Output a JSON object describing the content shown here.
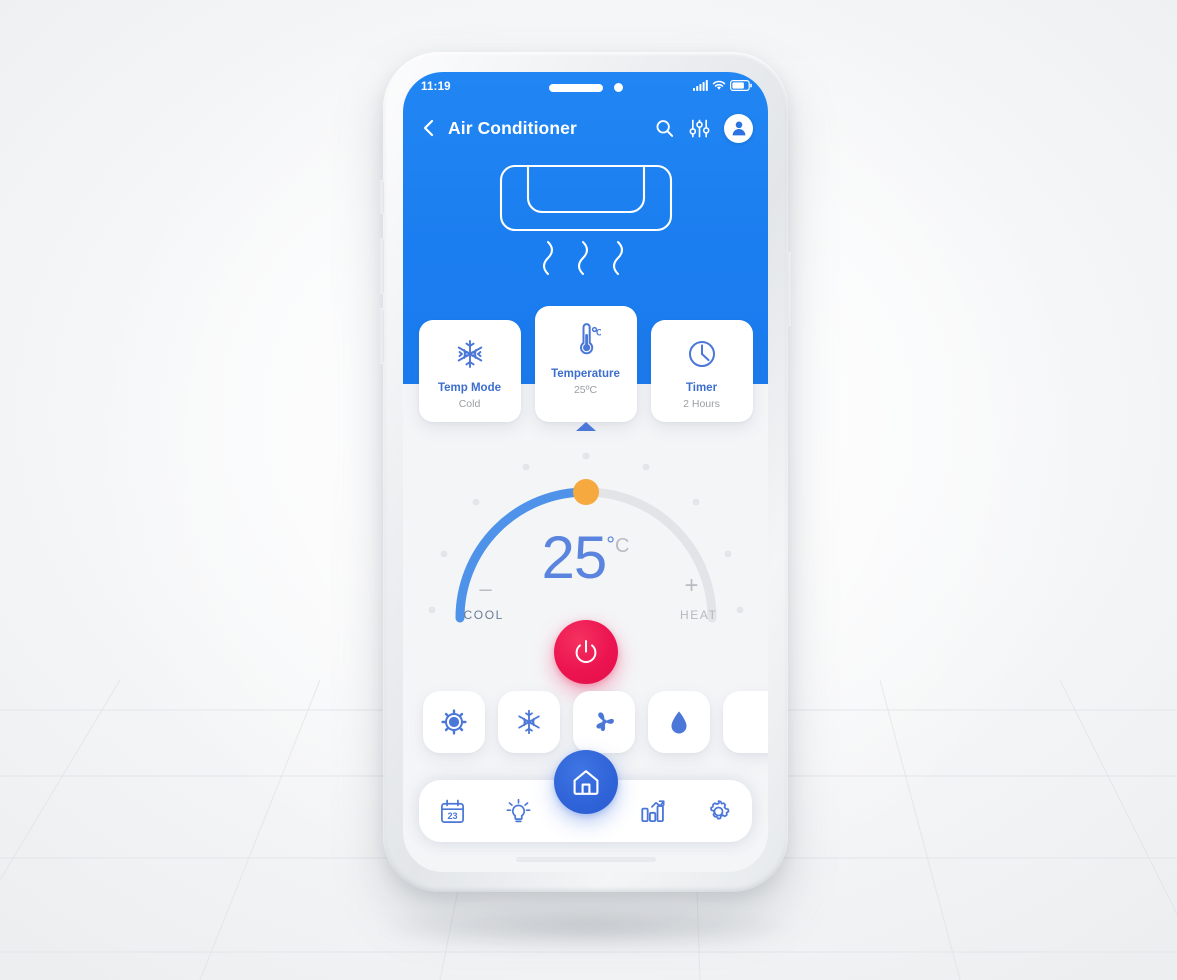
{
  "status_bar": {
    "time": "11:19",
    "icons": [
      "signal-icon",
      "wifi-icon",
      "battery-icon"
    ]
  },
  "app_bar": {
    "back_icon": "chevron-left-icon",
    "title": "Air Conditioner",
    "actions": [
      "search-icon",
      "sliders-icon",
      "user-avatar-icon"
    ]
  },
  "hero": {
    "illustration": "air-conditioner-unit-icon",
    "airflow_lines": 3
  },
  "cards": [
    {
      "icon": "snowflake-icon",
      "title": "Temp Mode",
      "value": "Cold",
      "active": false
    },
    {
      "icon": "thermometer-icon",
      "title": "Temperature",
      "value": "25ºC",
      "active": true
    },
    {
      "icon": "clock-icon",
      "title": "Timer",
      "value": "2 Hours",
      "active": false
    }
  ],
  "dial": {
    "temperature": "25",
    "degree_symbol": "°",
    "unit": "C",
    "minus_label": "–",
    "plus_label": "+",
    "cool_label": "COOL",
    "heat_label": "HEAT",
    "progress_percent": 50,
    "arc_active_color": "#4e92ea",
    "arc_track_color": "#e2e4e7",
    "knob_color": "#f5a93f",
    "power_button_color": "#ec1450",
    "power_icon": "power-icon"
  },
  "modes": [
    {
      "icon": "sun-icon",
      "name": "heat-mode"
    },
    {
      "icon": "snowflake-icon",
      "name": "cool-mode"
    },
    {
      "icon": "fan-icon",
      "name": "fan-mode"
    },
    {
      "icon": "water-drop-icon",
      "name": "dry-mode"
    },
    {
      "icon": "blank-icon",
      "name": "more-mode"
    }
  ],
  "bottom_nav": [
    {
      "icon": "calendar-icon",
      "label": "23",
      "active": false
    },
    {
      "icon": "lightbulb-icon",
      "label": "",
      "active": false
    },
    {
      "icon": "home-icon",
      "label": "",
      "active": true
    },
    {
      "icon": "bar-chart-icon",
      "label": "",
      "active": false
    },
    {
      "icon": "gear-icon",
      "label": "",
      "active": false
    }
  ],
  "theme": {
    "header_blue": "#1b7ef0",
    "accent_blue": "#3d6fd0",
    "home_blue": "#2f63d8",
    "red": "#ec1450",
    "orange": "#f5a93f",
    "screen_bg": "#f4f5f7"
  }
}
